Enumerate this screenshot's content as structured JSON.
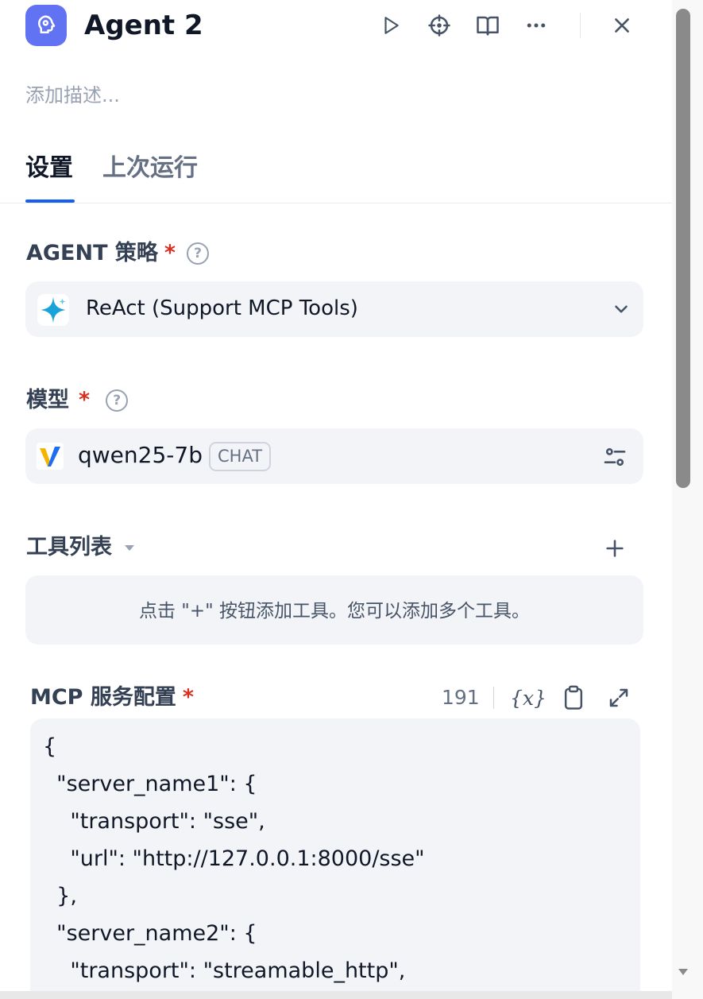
{
  "header": {
    "title": "Agent 2",
    "description_placeholder": "添加描述..."
  },
  "tabs": [
    {
      "label": "设置",
      "active": true
    },
    {
      "label": "上次运行",
      "active": false
    }
  ],
  "agent_strategy": {
    "label": "AGENT 策略",
    "required_mark": "*",
    "help": "?",
    "selected": "ReAct (Support MCP Tools)"
  },
  "model": {
    "label": "模型",
    "required_mark": "*",
    "help": "?",
    "name": "qwen25-7b",
    "badge": "CHAT"
  },
  "tools": {
    "label": "工具列表",
    "add": "+",
    "empty_hint": "点击 \"+\" 按钮添加工具。您可以添加多个工具。"
  },
  "mcp": {
    "label": "MCP 服务配置",
    "required_mark": "*",
    "char_count": "191",
    "variable_button": "{x}",
    "code_lines": [
      "{",
      "  \"server_name1\": {",
      "    \"transport\": \"sse\",",
      "    \"url\": \"http://127.0.0.1:8000/sse\"",
      "  },",
      "  \"server_name2\": {",
      "    \"transport\": \"streamable_http\","
    ]
  },
  "colors": {
    "accent": "#155eef",
    "agent_icon_bg": "#6172f3",
    "required": "#d92d20",
    "field_bg": "#f2f4f7"
  }
}
